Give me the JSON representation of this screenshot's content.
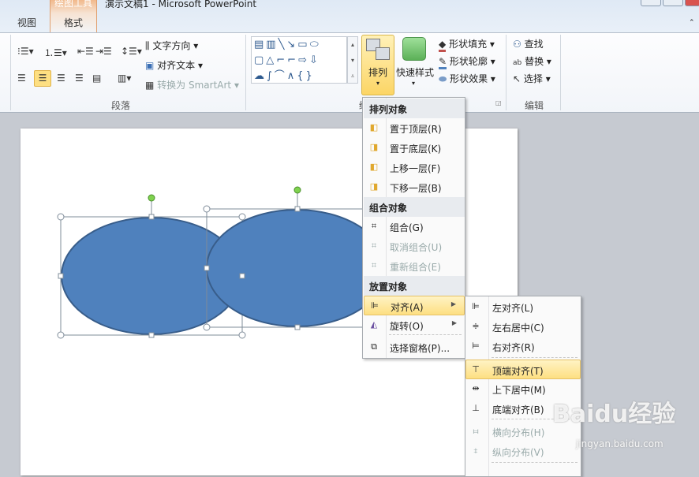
{
  "titlebar": {
    "context_tab": "绘图工具",
    "title": "演示文稿1 - Microsoft PowerPoint"
  },
  "tabs": [
    {
      "label": "视图"
    },
    {
      "label": "格式",
      "active": true
    }
  ],
  "ribbon": {
    "paragraph": {
      "label": "段落",
      "text_direction": "文字方向",
      "align_text": "对齐文本",
      "convert_smartart": "转换为 SmartArt"
    },
    "shapes_group_label": "绘",
    "arrange": {
      "label": "排列"
    },
    "quick_styles": {
      "label": "快速样式"
    },
    "shape_fill": "形状填充",
    "shape_outline": "形状轮廓",
    "shape_effects": "形状效果",
    "editing": {
      "label": "编辑",
      "find": "查找",
      "replace": "替换",
      "select": "选择"
    }
  },
  "arrange_menu": {
    "section1": "排列对象",
    "bring_front": "置于顶层(R)",
    "send_back": "置于底层(K)",
    "forward": "上移一层(F)",
    "backward": "下移一层(B)",
    "section2": "组合对象",
    "group": "组合(G)",
    "ungroup": "取消组合(U)",
    "regroup": "重新组合(E)",
    "section3": "放置对象",
    "align": "对齐(A)",
    "rotate": "旋转(O)",
    "selection_pane": "选择窗格(P)..."
  },
  "align_submenu": {
    "left": "左对齐(L)",
    "center": "左右居中(C)",
    "right": "右对齐(R)",
    "top": "顶端对齐(T)",
    "middle": "上下居中(M)",
    "bottom": "底端对齐(B)",
    "dist_h": "横向分布(H)",
    "dist_v": "纵向分布(V)"
  },
  "watermark": {
    "text": "Baidu经验",
    "sub": "jingyan.baidu.com"
  },
  "colors": {
    "shape_fill": "#4f81bd",
    "shape_outline": "#385d8a",
    "highlight": "#fddf82"
  }
}
